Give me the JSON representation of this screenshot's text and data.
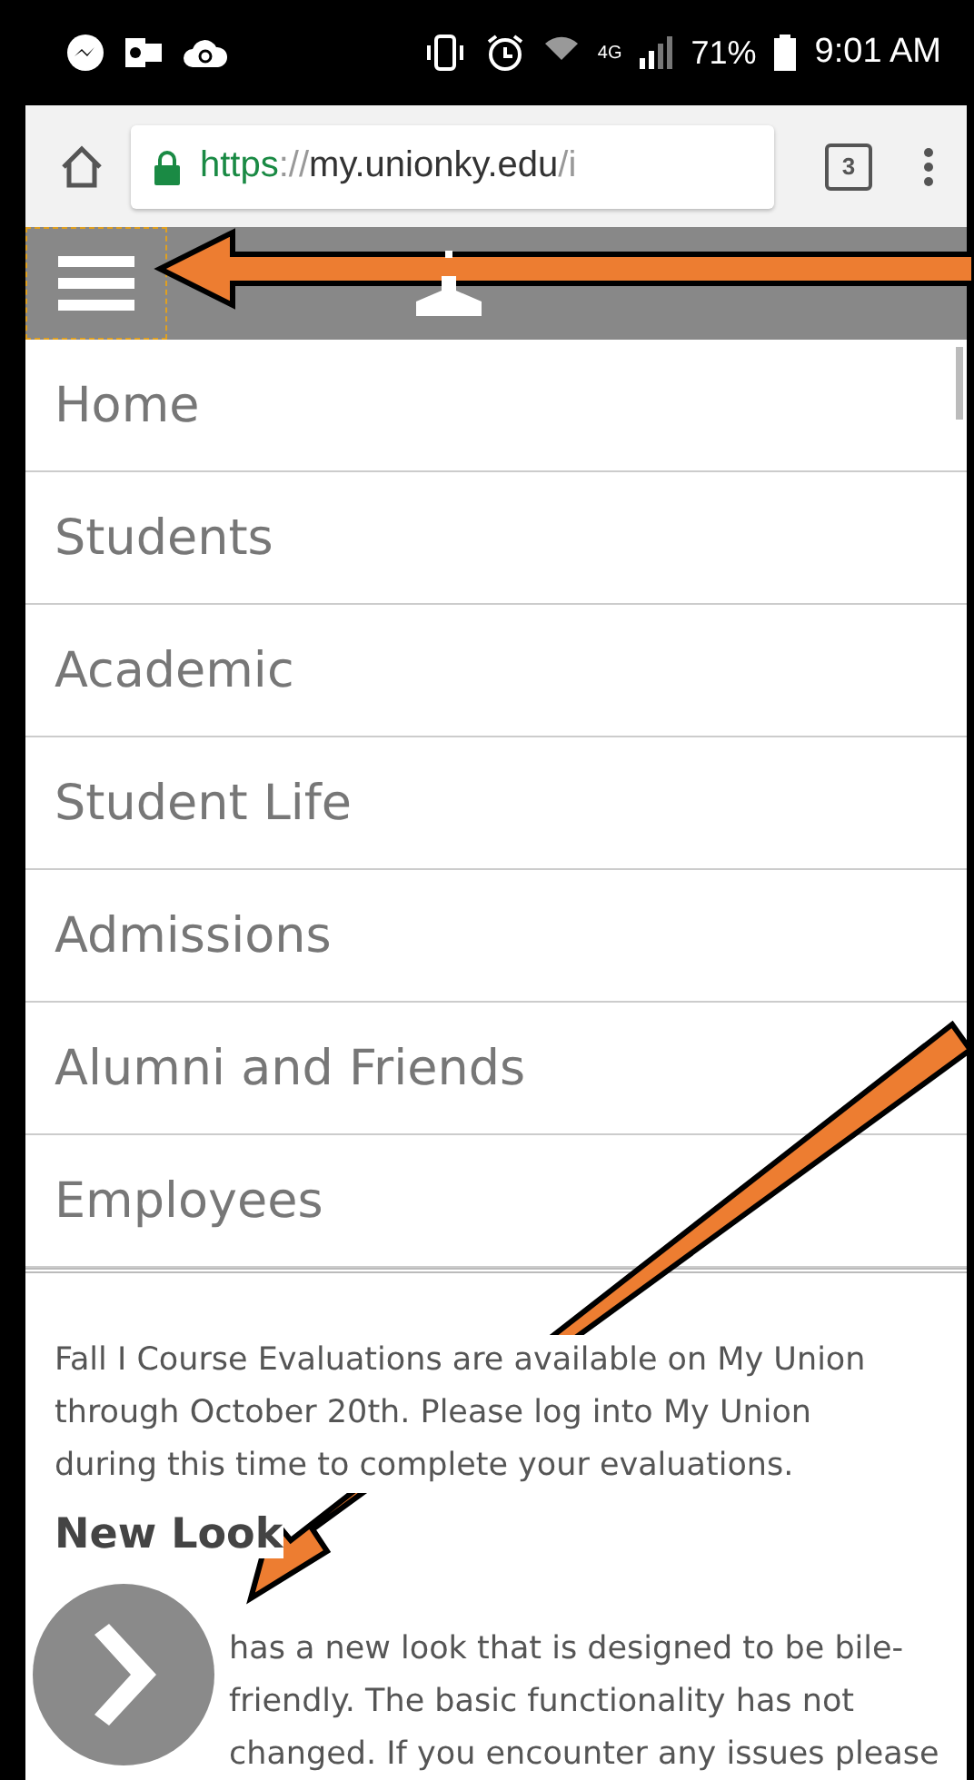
{
  "status_bar": {
    "network": "4G",
    "battery": "71%",
    "time": "9:01 AM"
  },
  "browser": {
    "url_scheme": "https",
    "url_separator": "://",
    "url_host": "my.unionky.edu",
    "url_path": "/i",
    "tab_count": "3"
  },
  "menu": {
    "items": [
      {
        "label": "Home"
      },
      {
        "label": "Students"
      },
      {
        "label": "Academic"
      },
      {
        "label": "Student Life"
      },
      {
        "label": "Admissions"
      },
      {
        "label": "Alumni and Friends"
      },
      {
        "label": "Employees"
      }
    ]
  },
  "content": {
    "notice": "Fall I Course Evaluations are available on My Union through October 20th. Please log into My Union during this time to complete your evaluations.",
    "heading": "New Look",
    "paragraph": "has a new look that is designed to be bile-friendly. The basic functionality has not changed. If you encounter any issues please"
  }
}
